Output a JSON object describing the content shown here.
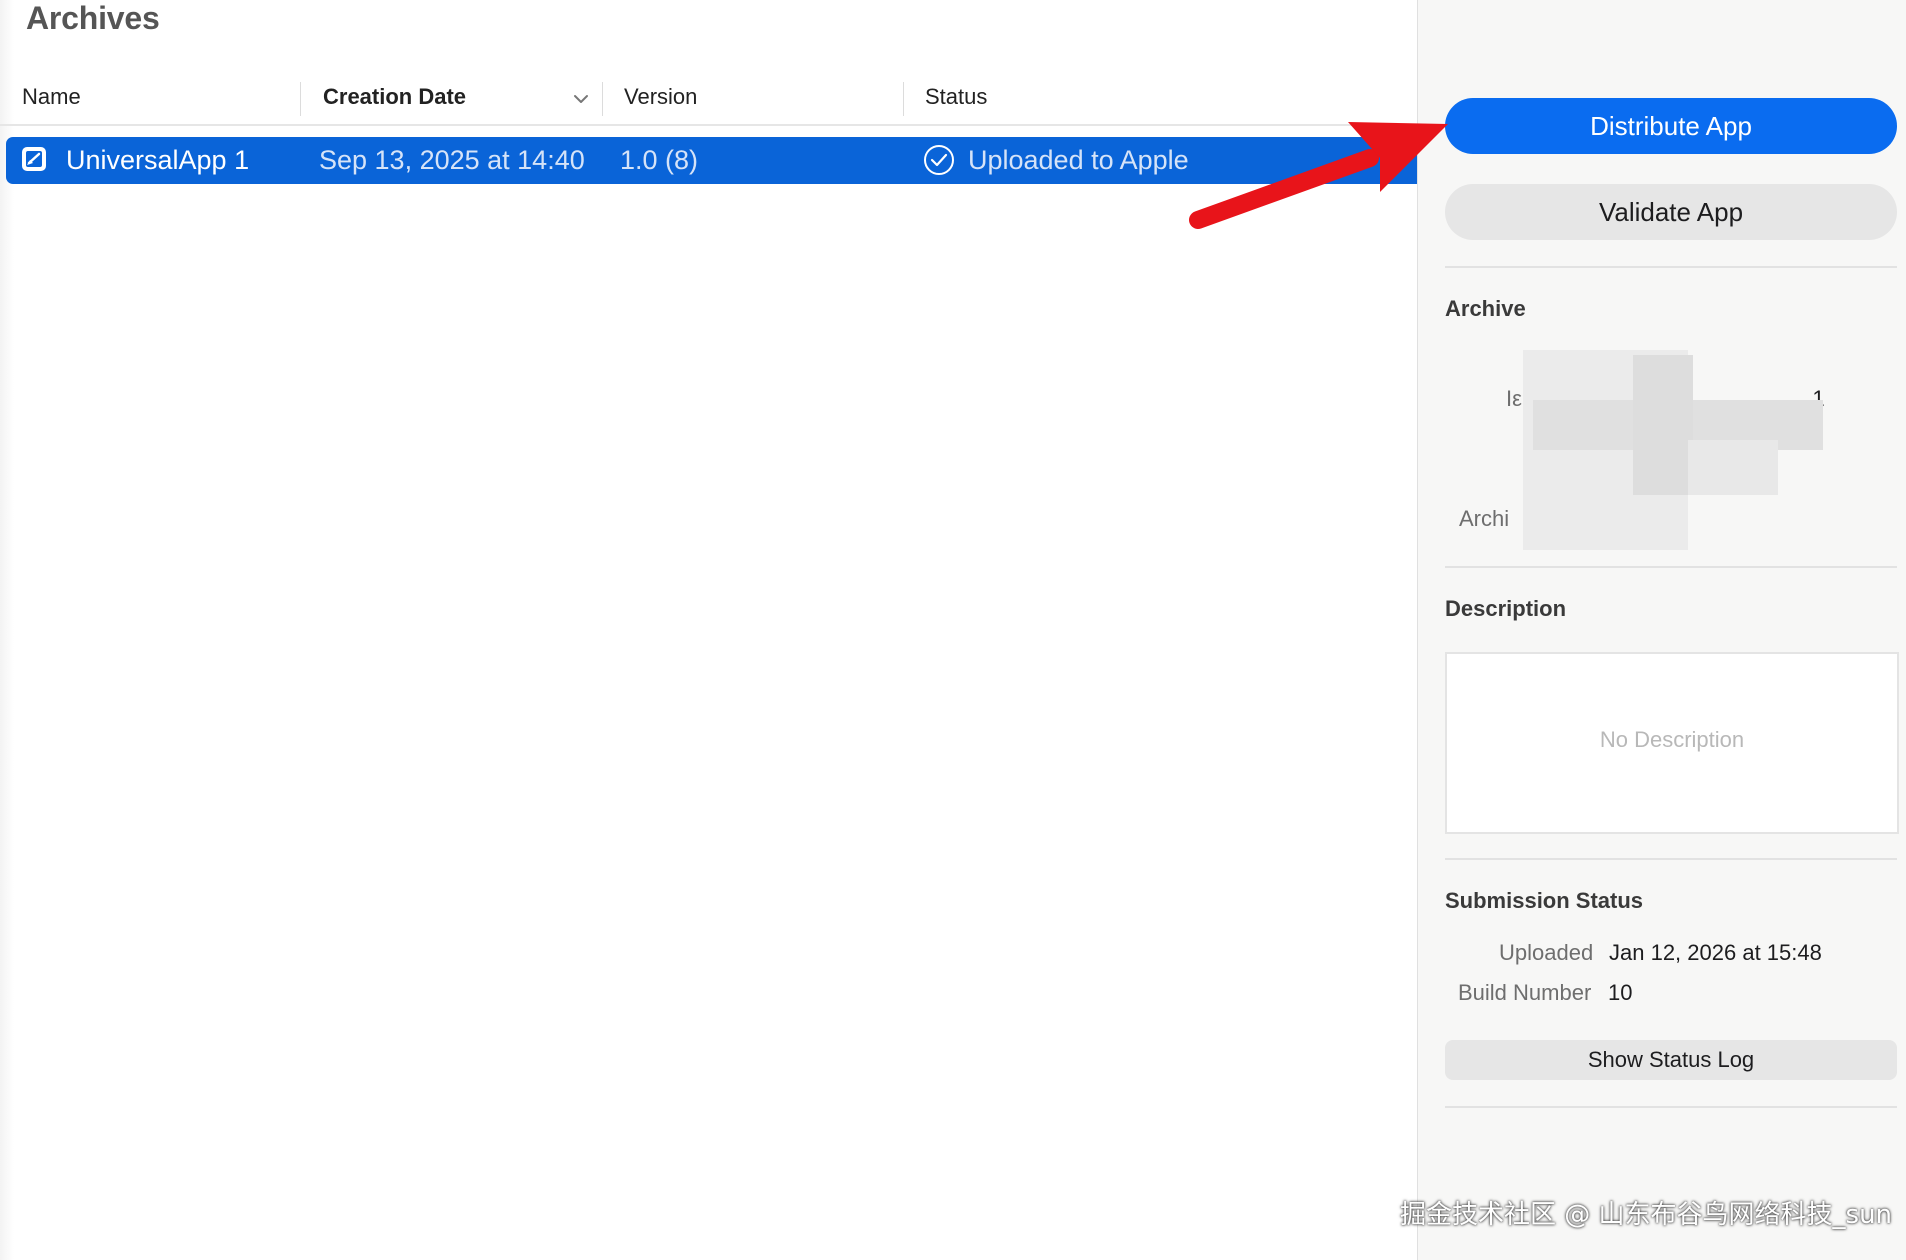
{
  "left": {
    "title": "Archives",
    "columns": {
      "name": "Name",
      "creation_date": "Creation Date",
      "version": "Version",
      "status": "Status"
    },
    "rows": [
      {
        "name": "UniversalApp 1",
        "date": "Sep 13, 2025 at 14:40",
        "version": "1.0 (8)",
        "status": "Uploaded to Apple"
      }
    ]
  },
  "right": {
    "distribute_label": "Distribute App",
    "validate_label": "Validate App",
    "archive": {
      "title": "Archive",
      "fragment_left": "Iε",
      "fragment_right": " 1",
      "fragment_label": "Archi"
    },
    "description": {
      "title": "Description",
      "placeholder": "No Description"
    },
    "submission": {
      "title": "Submission Status",
      "uploaded_label": "Uploaded",
      "uploaded_value": "Jan 12, 2026 at 15:48",
      "build_label": "Build Number",
      "build_value": "10",
      "log_button": "Show Status Log"
    }
  },
  "watermark": "掘金技术社区 @ 山东布谷鸟网络科技_sun",
  "colors": {
    "selection": "#0a64d8",
    "primary_button": "#0a6cf0",
    "arrow": "#e8141a"
  },
  "icons": [
    "app-icon",
    "checkmark-circle-icon",
    "chevron-down-icon",
    "red-arrow-annotation"
  ]
}
